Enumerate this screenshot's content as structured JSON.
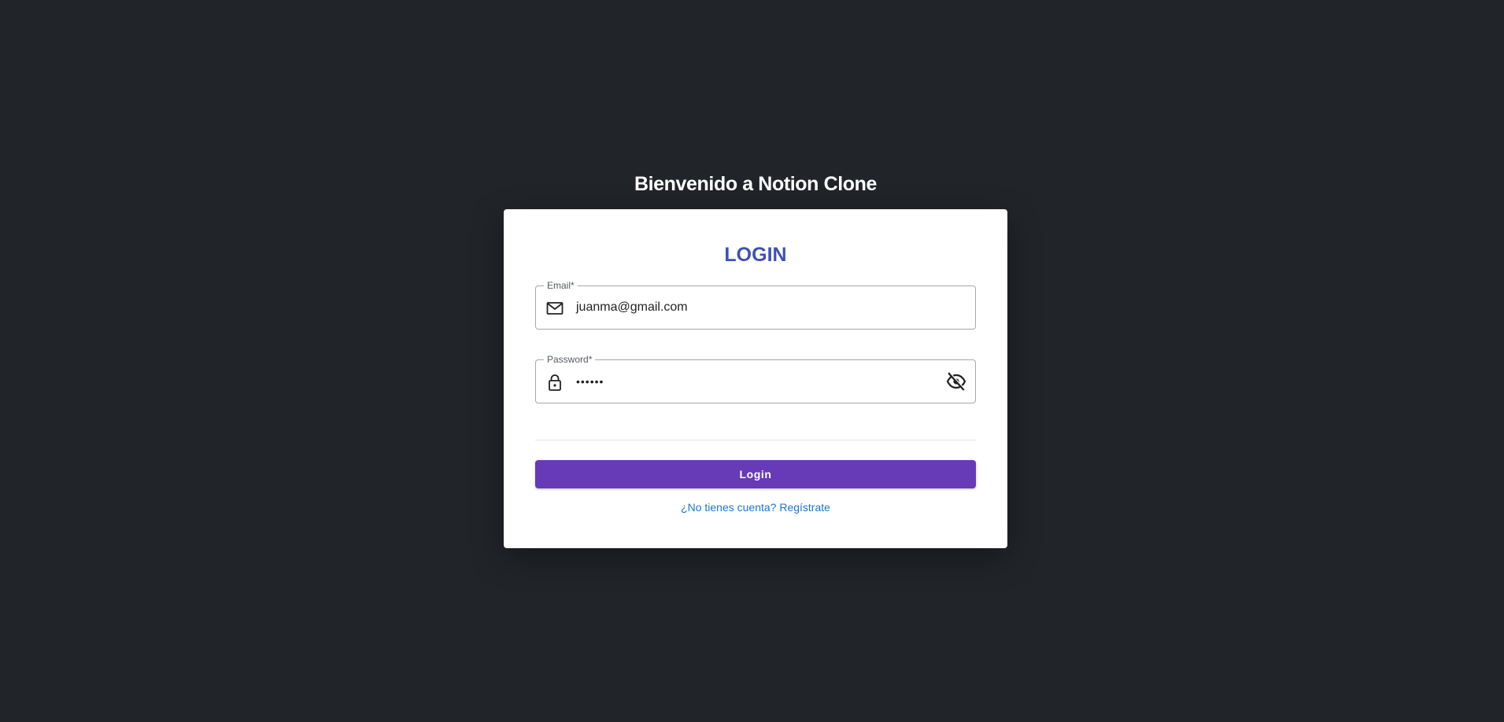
{
  "page": {
    "title": "Bienvenido a Notion Clone"
  },
  "colors": {
    "background": "#212429",
    "card": "#ffffff",
    "heading": "#3f51b5",
    "primary_button": "#673ab7",
    "link": "#1976d2"
  },
  "login_form": {
    "heading": "LOGIN",
    "email": {
      "label": "Email*",
      "value": "juanma@gmail.com",
      "icon": "mail-icon"
    },
    "password": {
      "label": "Password*",
      "value": "••••••",
      "icon": "lock-icon",
      "toggle_icon": "visibility-off-icon"
    },
    "submit_label": "Login",
    "register_link": "¿No tienes cuenta? Regístrate"
  }
}
